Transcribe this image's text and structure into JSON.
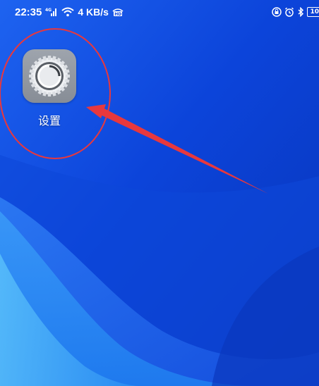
{
  "status_bar": {
    "time": "22:35",
    "network_speed": "4 KB/s",
    "battery_level": "10",
    "icons": [
      "signal-icon",
      "wifi-icon",
      "hd-icon",
      "lock-rotation-icon",
      "alarm-icon",
      "bluetooth-icon",
      "battery-icon"
    ]
  },
  "home": {
    "apps": [
      {
        "label": "设置",
        "icon": "gear-icon"
      }
    ]
  },
  "annotation": {
    "color": "#e8383d"
  },
  "colors": {
    "wallpaper_primary": "#0a3fd6",
    "icon_background": "#9ea4ad"
  }
}
